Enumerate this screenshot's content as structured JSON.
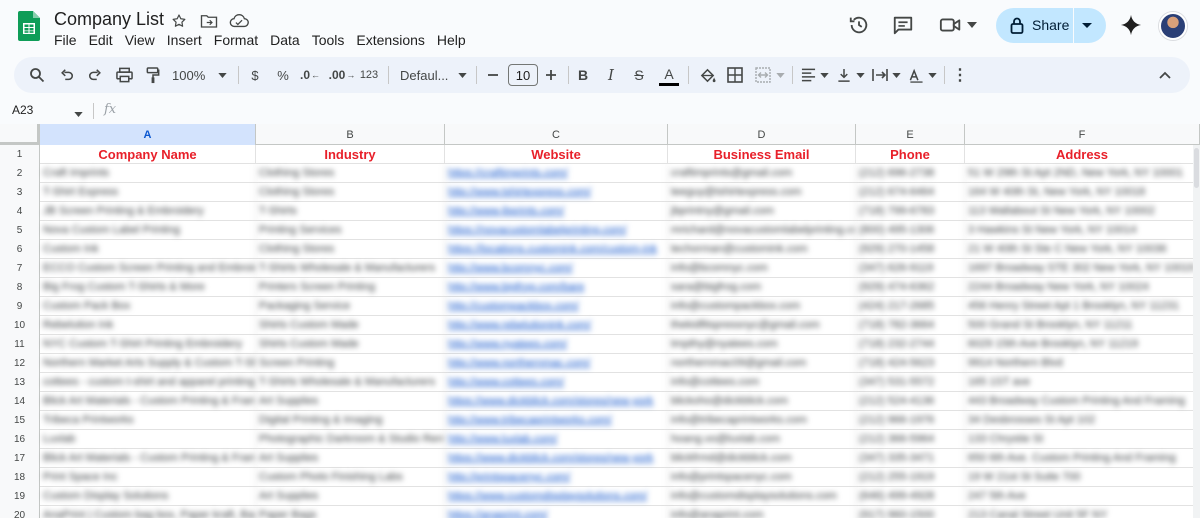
{
  "app": {
    "title": "Company List",
    "menu": [
      "File",
      "Edit",
      "View",
      "Insert",
      "Format",
      "Data",
      "Tools",
      "Extensions",
      "Help"
    ],
    "share_label": "Share"
  },
  "toolbar": {
    "zoom": "100%",
    "currency": "$",
    "percent": "%",
    "decrease_decimal": ".0",
    "increase_decimal": ".00",
    "number_format": "123",
    "font": "Defaul...",
    "font_size": "10",
    "bold": "B",
    "italic": "I",
    "strikethrough": "S",
    "text_color": "A",
    "more": "⋮"
  },
  "formula_bar": {
    "cell_ref": "A23",
    "fx": "fx",
    "value": ""
  },
  "grid": {
    "selected_column": "A",
    "columns": [
      {
        "letter": "A"
      },
      {
        "letter": "B"
      },
      {
        "letter": "C"
      },
      {
        "letter": "D"
      },
      {
        "letter": "E"
      },
      {
        "letter": "F"
      }
    ],
    "header_row": [
      "Company Name",
      "Industry",
      "Website",
      "Business Email",
      "Phone",
      "Address"
    ],
    "rows": [
      {
        "n": "2",
        "cells": [
          "Craft Imprints",
          "Clothing Stores",
          "https://craftimprints.com/",
          "craftimprints@gmail.com",
          "(212) 696-2738",
          "51 W 29th St Apt 2ND, New York, NY 10001"
        ]
      },
      {
        "n": "3",
        "cells": [
          "T-Shirt Express",
          "Clothing Stores",
          "http://www.tshirtexpress.com/",
          "teeguy@tshirtexpress.com",
          "(212) 674-6464",
          "164 W 40th St, New York, NY 10018"
        ]
      },
      {
        "n": "4",
        "cells": [
          "JB Screen Printing & Embroidery",
          "T-Shirts",
          "http://www.jbprints.com/",
          "jbprintny@gmail.com",
          "(718) 799-6783",
          "113 Wallabout St New York, NY 10002"
        ]
      },
      {
        "n": "5",
        "cells": [
          "Nova Custom Label Printing",
          "Printing Services",
          "https://novacustomlabelprinting.com/",
          "mrichard@novacustomlabelprinting.com",
          "(800) 495-1306",
          "3 Hawkins St New York, NY 10014"
        ]
      },
      {
        "n": "6",
        "cells": [
          "Custom Ink",
          "Clothing Stores",
          "https://locations.customink.com/custom-ink",
          "techorman@customink.com",
          "(929) 270-1458",
          "21 W 40th St Ste C New York, NY 10036"
        ]
      },
      {
        "n": "7",
        "cells": [
          "ECCO Custom Screen Printing and Embroidery",
          "T-Shirts Wholesale & Manufacturers",
          "http://www.bcomnyc.com/",
          "info@bcomnyc.com",
          "(347) 626-9119",
          "1697 Broadway STE 302 New York, NY 10019"
        ]
      },
      {
        "n": "8",
        "cells": [
          "Big Frog Custom T-Shirts & More",
          "Printers Screen Printing",
          "http://www.bigfrog.com/bare",
          "sara@bigfrog.com",
          "(929) 474-6362",
          "2244 Broadway New York, NY 10024"
        ]
      },
      {
        "n": "9",
        "cells": [
          "Custom Pack Box",
          "Packaging Service",
          "http://custompackbox.com/",
          "info@custompackbox.com",
          "(424) 217-2685",
          "456 Henry Street Apt 1 Brooklyn, NY 11231"
        ]
      },
      {
        "n": "10",
        "cells": [
          "Rebelution Ink",
          "Shirts Custom Made",
          "http://www.rebelutionink.com/",
          "thekidfitspressnyc@gmail.com",
          "(718) 782-3664",
          "500 Grand St Brooklyn, NY 11211"
        ]
      },
      {
        "n": "11",
        "cells": [
          "NYC Custom T-Shirt Printing Embroidery",
          "Shirts Custom Made",
          "http://www.nyatees.com/",
          "tmpthy@nyatees.com",
          "(718) 232-2744",
          "6029 15th Ave Brooklyn, NY 11219"
        ]
      },
      {
        "n": "12",
        "cells": [
          "Northern Market Arts Supply & Custom T-Shirts",
          "Screen Printing",
          "http://www.northernmac.com/",
          "northernmac09@gmail.com",
          "(718) 424-5623",
          "9914 Northern Blvd"
        ]
      },
      {
        "n": "13",
        "cells": [
          "cottees - custom t-shirt and apparel printing",
          "T-Shirts Wholesale & Manufacturers",
          "http://www.cottees.com/",
          "info@cottees.com",
          "(347) 531-5572",
          "165 1ST ave"
        ]
      },
      {
        "n": "14",
        "cells": [
          "Blick Art Materials - Custom Printing & Framing",
          "Art Supplies",
          "https://www.dickblick.com/stores/new-york",
          "blickoho@dickblick.com",
          "(212) 524-4136",
          "443 Broadway Custom Printing And Framing"
        ]
      },
      {
        "n": "15",
        "cells": [
          "Tribeca Printworks",
          "Digital Printing & Imaging",
          "http://www.tribecaprintworks.com/",
          "info@tribecaprintworks.com",
          "(212) 966-1976",
          "34 Desbrosses St Apt 102"
        ]
      },
      {
        "n": "16",
        "cells": [
          "Luxlab",
          "Photographic Darkroom & Studio Rentals",
          "http://www.luxlab.com/",
          "hoang.vo@luxlab.com",
          "(212) 366-5964",
          "133 Chrystie St"
        ]
      },
      {
        "n": "17",
        "cells": [
          "Blick Art Materials - Custom Printing & Framing",
          "Art Supplies",
          "https://www.dickblick.com/stores/new-york",
          "blickfrmd@dickblick.com",
          "(347) 335-3471",
          "650 6th Ave. Custom Printing And Framing"
        ]
      },
      {
        "n": "18",
        "cells": [
          "Print Space Inc",
          "Custom Photo Finishing Labs",
          "http://printspacenyc.com/",
          "info@printspacenyc.com",
          "(212) 255-1919",
          "19 W 21st St Suite 700"
        ]
      },
      {
        "n": "19",
        "cells": [
          "Custom Display Solutions",
          "Art Supplies",
          "https://www.customdisplaysolutions.com/",
          "info@customdisplaysolutions.com",
          "(646) 499-4928",
          "247 5th Ave"
        ]
      },
      {
        "n": "20",
        "cells": [
          "AnaPrint | Custom bag box, Paper kraft, Bags",
          "Paper Bags",
          "https://anaprint.com/",
          "info@anaprint.com",
          "(917) 960-1500",
          "213 Canal Street Unit 5F NY"
        ]
      }
    ]
  }
}
